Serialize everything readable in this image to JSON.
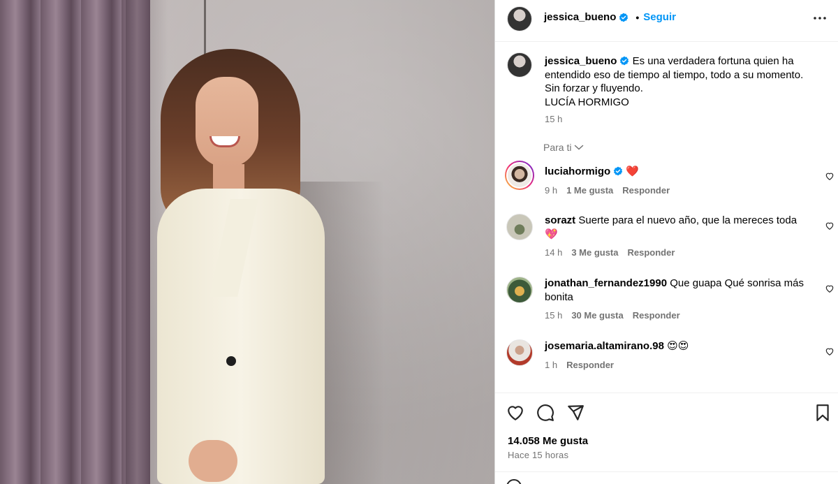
{
  "post": {
    "author": "jessica_bueno",
    "follow_label": "Seguir",
    "dot": "•",
    "caption_lines": [
      "Es una verdadera fortuna quien ha",
      "entendido eso de tiempo al tiempo, todo a su momento.",
      "Sin forzar y fluyendo.",
      "LUCÍA HORMIGO"
    ],
    "caption_time": "15 h",
    "filter_label": "Para ti",
    "likes": "14.058 Me gusta",
    "posted_ago": "Hace 15 horas"
  },
  "comments": [
    {
      "user": "luciahormigo",
      "verified": true,
      "text": "❤️",
      "time": "9 h",
      "likes": "1 Me gusta",
      "reply": "Responder"
    },
    {
      "user": "sorazt",
      "verified": false,
      "text": "Suerte para el nuevo año, que la mereces toda 💖",
      "time": "14 h",
      "likes": "3 Me gusta",
      "reply": "Responder"
    },
    {
      "user": "jonathan_fernandez1990",
      "verified": false,
      "text": "Que guapa Qué sonrisa más bonita",
      "time": "15 h",
      "likes": "30 Me gusta",
      "reply": "Responder"
    },
    {
      "user": "josemaria.altamirano.98",
      "verified": false,
      "text": "😍😍",
      "time": "1 h",
      "likes": "",
      "reply": "Responder"
    }
  ],
  "icons": {
    "more": "more-horizontal-icon",
    "verified": "verified-badge-icon",
    "chevron": "chevron-down-icon",
    "comment_like": "heart-outline-icon",
    "like": "heart-icon",
    "comment": "comment-bubble-icon",
    "share": "paper-plane-icon",
    "save": "bookmark-icon"
  },
  "colors": {
    "link": "#0095f6",
    "verified": "#0095f6",
    "muted": "#737373",
    "heart_red": "#ed4956"
  }
}
